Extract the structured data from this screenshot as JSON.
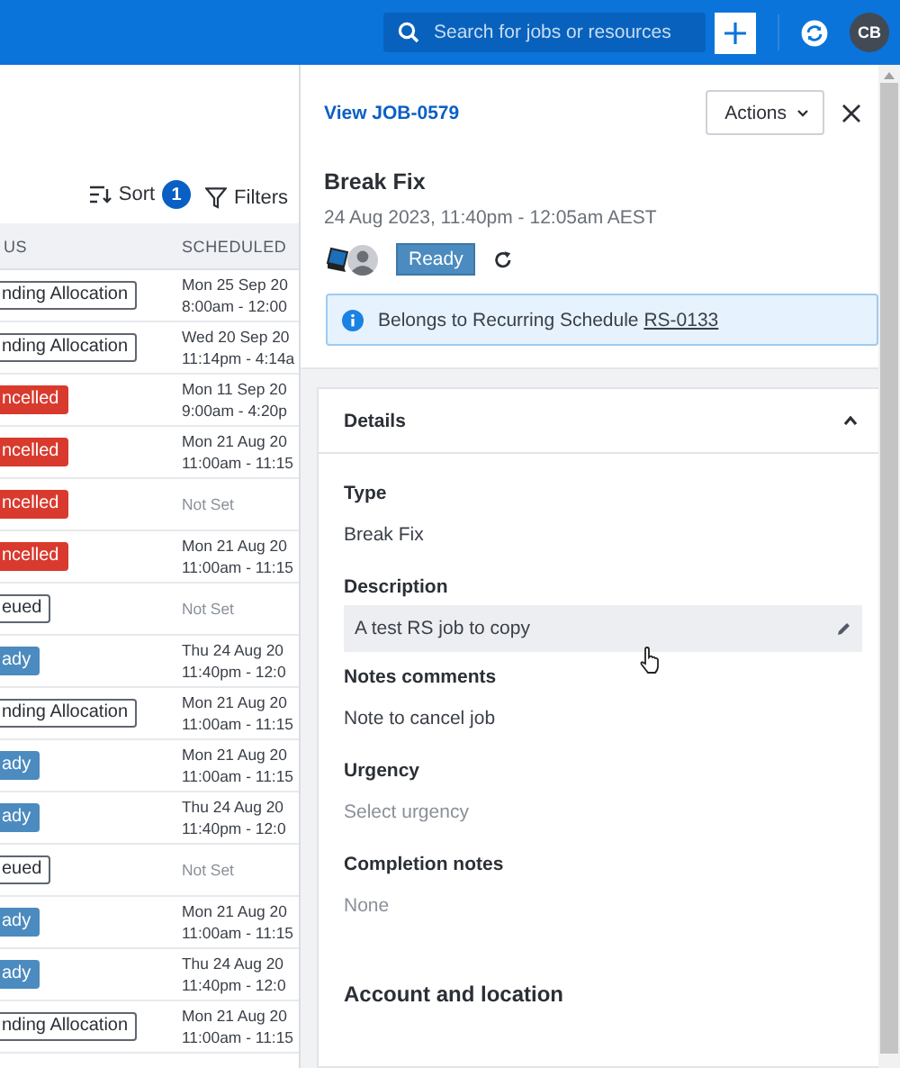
{
  "top_bar": {
    "search": {
      "placeholder": "Search for jobs or resources"
    },
    "avatar": "CB"
  },
  "list": {
    "toolbar": {
      "sort_label": "Sort",
      "sort_count": "1",
      "filters_label": "Filters"
    },
    "columns": [
      "US",
      "SCHEDULED"
    ],
    "rows": [
      {
        "kind": "outline",
        "status": "nding Allocation",
        "scheduled": [
          "Mon 25 Sep 20",
          "8:00am - 12:00"
        ]
      },
      {
        "kind": "outline",
        "status": "nding Allocation",
        "scheduled": [
          "Wed 20 Sep 20",
          "11:14pm - 4:14a"
        ]
      },
      {
        "kind": "cancelled",
        "status": "ncelled",
        "scheduled": [
          "Mon 11 Sep 20",
          "9:00am - 4:20p"
        ]
      },
      {
        "kind": "cancelled",
        "status": "ncelled",
        "scheduled": [
          "Mon 21 Aug 20",
          "11:00am - 11:15"
        ]
      },
      {
        "kind": "cancelled",
        "status": "ncelled",
        "scheduled": [
          "Not Set"
        ]
      },
      {
        "kind": "cancelled",
        "status": "ncelled",
        "scheduled": [
          "Mon 21 Aug 20",
          "11:00am - 11:15"
        ]
      },
      {
        "kind": "outline",
        "status": "eued",
        "scheduled": [
          "Not Set"
        ]
      },
      {
        "kind": "ready",
        "status": "ady",
        "scheduled": [
          "Thu 24 Aug 20",
          "11:40pm - 12:0"
        ]
      },
      {
        "kind": "outline",
        "status": "nding Allocation",
        "scheduled": [
          "Mon 21 Aug 20",
          "11:00am - 11:15"
        ]
      },
      {
        "kind": "ready",
        "status": "ady",
        "scheduled": [
          "Mon 21 Aug 20",
          "11:00am - 11:15"
        ]
      },
      {
        "kind": "ready",
        "status": "ady",
        "scheduled": [
          "Thu 24 Aug 20",
          "11:40pm - 12:0"
        ]
      },
      {
        "kind": "outline",
        "status": "eued",
        "scheduled": [
          "Not Set"
        ]
      },
      {
        "kind": "ready",
        "status": "ady",
        "scheduled": [
          "Mon 21 Aug 20",
          "11:00am - 11:15"
        ]
      },
      {
        "kind": "ready",
        "status": "ady",
        "scheduled": [
          "Thu 24 Aug 20",
          "11:40pm - 12:0"
        ]
      },
      {
        "kind": "outline",
        "status": "nding Allocation",
        "scheduled": [
          "Mon 21 Aug 20",
          "11:00am - 11:15"
        ]
      }
    ]
  },
  "detail": {
    "link": "View JOB-0579",
    "actions": "Actions",
    "title": "Break Fix",
    "time": "24 Aug 2023, 11:40pm - 12:05am AEST",
    "status": "Ready",
    "banner": {
      "text": "Belongs to Recurring Schedule",
      "link": "RS-0133"
    },
    "section": {
      "title": "Details",
      "expanded": true,
      "fields": [
        {
          "kind": "text",
          "label": "Type",
          "value": "Break Fix"
        },
        {
          "kind": "editable",
          "label": "Description",
          "value": "A test RS job to copy"
        },
        {
          "kind": "text",
          "label": "Notes comments",
          "value": "Note to cancel job"
        },
        {
          "kind": "empty",
          "label": "Urgency",
          "placeholder": "Select urgency"
        },
        {
          "kind": "empty",
          "label": "Completion notes",
          "placeholder": "None"
        }
      ]
    },
    "next_section": "Account and location"
  }
}
